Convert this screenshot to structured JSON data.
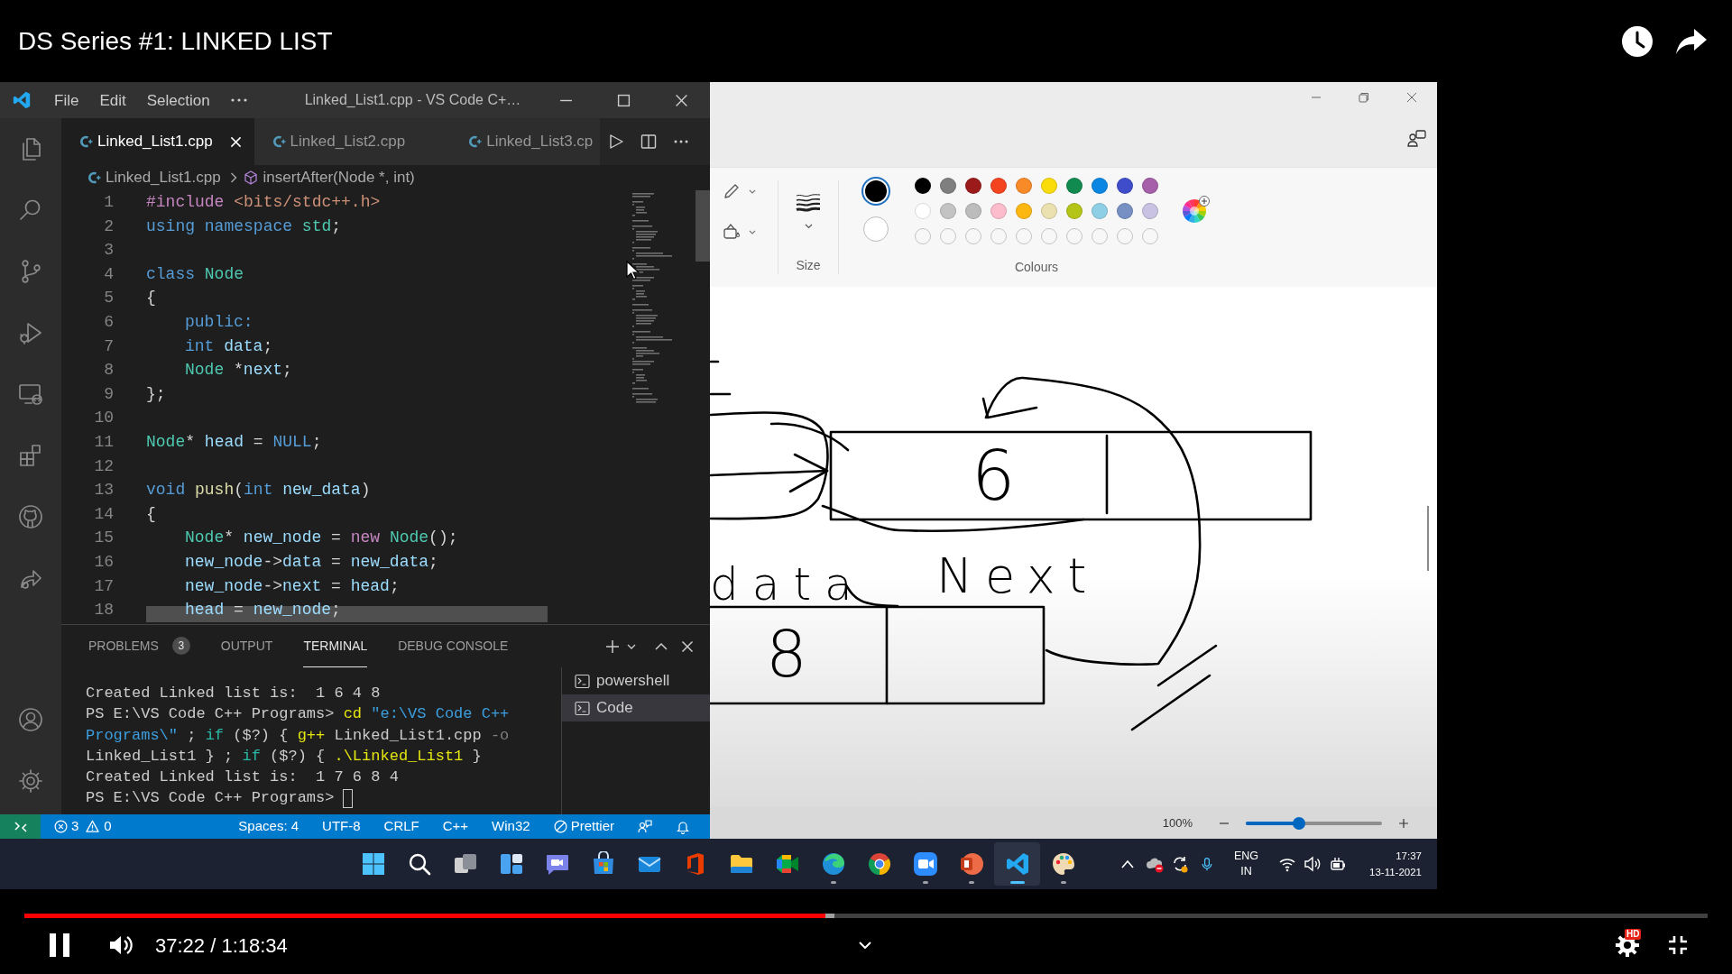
{
  "video": {
    "title": "DS Series #1: LINKED LIST"
  },
  "vscode": {
    "menu": [
      "File",
      "Edit",
      "Selection"
    ],
    "title": "Linked_List1.cpp - VS Code C+…",
    "tabs": [
      {
        "label": "Linked_List1.cpp",
        "selected": true
      },
      {
        "label": "Linked_List2.cpp",
        "selected": false
      },
      {
        "label": "Linked_List3.cp",
        "selected": false
      }
    ],
    "breadcrumb": {
      "file": "Linked_List1.cpp",
      "symbol": "insertAfter(Node *, int)"
    },
    "code": [
      {
        "number": "1",
        "tokens": [
          {
            "kind": "directive",
            "text": "#include"
          },
          {
            "kind": "string",
            "text": " <bits/stdc++.h>"
          }
        ]
      },
      {
        "number": "2",
        "tokens": [
          {
            "kind": "keyword",
            "text": "using"
          },
          {
            "kind": "keyword",
            "text": " namespace"
          },
          {
            "kind": "type",
            "text": " std"
          },
          {
            "kind": "plain",
            "text": ";"
          }
        ]
      },
      {
        "number": "3"
      },
      {
        "number": "4",
        "tokens": [
          {
            "kind": "keyword",
            "text": "class"
          },
          {
            "kind": "type",
            "text": " Node"
          }
        ]
      },
      {
        "number": "5",
        "tokens": [
          {
            "kind": "plain",
            "text": "{"
          }
        ],
        "children": [
          {
            "number": "6",
            "tokens": [
              {
                "kind": "keyword",
                "text": "public:"
              }
            ]
          },
          {
            "number": "7",
            "tokens": [
              {
                "kind": "keyword",
                "text": "int"
              },
              {
                "kind": "variable",
                "text": " data"
              },
              {
                "kind": "plain",
                "text": ";"
              }
            ]
          },
          {
            "number": "8",
            "tokens": [
              {
                "kind": "type",
                "text": "Node"
              },
              {
                "kind": "plain",
                "text": " *"
              },
              {
                "kind": "variable",
                "text": "next"
              },
              {
                "kind": "plain",
                "text": ";"
              }
            ]
          }
        ]
      },
      {
        "number": "9",
        "tokens": [
          {
            "kind": "plain",
            "text": "};"
          }
        ]
      },
      {
        "number": "10"
      },
      {
        "number": "11",
        "tokens": [
          {
            "kind": "type",
            "text": "Node"
          },
          {
            "kind": "plain",
            "text": "*"
          },
          {
            "kind": "variable",
            "text": " head"
          },
          {
            "kind": "plain",
            "text": " ="
          },
          {
            "kind": "keyword",
            "text": " NULL"
          },
          {
            "kind": "plain",
            "text": ";"
          }
        ]
      },
      {
        "number": "12"
      },
      {
        "number": "13",
        "tokens": [
          {
            "kind": "keyword",
            "text": "void"
          },
          {
            "kind": "function",
            "text": " push"
          },
          {
            "kind": "plain",
            "text": "("
          },
          {
            "kind": "keyword",
            "text": "int"
          },
          {
            "kind": "variable",
            "text": " new_data"
          },
          {
            "kind": "plain",
            "text": ")"
          }
        ]
      },
      {
        "number": "14",
        "tokens": [
          {
            "kind": "plain",
            "text": "{"
          }
        ],
        "children": [
          {
            "number": "15",
            "tokens": [
              {
                "kind": "type",
                "text": "Node"
              },
              {
                "kind": "plain",
                "text": "*"
              },
              {
                "kind": "variable",
                "text": " new_node"
              },
              {
                "kind": "plain",
                "text": " ="
              },
              {
                "kind": "control",
                "text": " new"
              },
              {
                "kind": "type",
                "text": " Node"
              },
              {
                "kind": "plain",
                "text": "();"
              }
            ]
          },
          {
            "number": "16",
            "tokens": [
              {
                "kind": "variable",
                "text": "new_node"
              },
              {
                "kind": "plain",
                "text": "->"
              },
              {
                "kind": "variable",
                "text": "data"
              },
              {
                "kind": "plain",
                "text": " ="
              },
              {
                "kind": "variable",
                "text": " new_data"
              },
              {
                "kind": "plain",
                "text": ";"
              }
            ]
          },
          {
            "number": "17",
            "tokens": [
              {
                "kind": "variable",
                "text": "new_node"
              },
              {
                "kind": "plain",
                "text": "->"
              },
              {
                "kind": "variable",
                "text": "next"
              },
              {
                "kind": "plain",
                "text": " ="
              },
              {
                "kind": "variable",
                "text": " head"
              },
              {
                "kind": "plain",
                "text": ";"
              }
            ]
          },
          {
            "number": "18",
            "tokens": [
              {
                "kind": "variable",
                "text": "head"
              },
              {
                "kind": "plain",
                "text": " ="
              },
              {
                "kind": "variable",
                "text": " new_node"
              },
              {
                "kind": "plain",
                "text": ";"
              }
            ]
          }
        ]
      }
    ],
    "panel_tabs": [
      {
        "label": "PROBLEMS",
        "badge": "3",
        "selected": false
      },
      {
        "label": "OUTPUT",
        "selected": false
      },
      {
        "label": "TERMINAL",
        "selected": true
      },
      {
        "label": "DEBUG CONSOLE",
        "selected": false
      }
    ],
    "terminal": [
      {
        "tokens": [
          {
            "kind": "text",
            "text": "Created Linked list is:  1 6 4 8"
          }
        ]
      },
      {
        "tokens": [
          {
            "kind": "text",
            "text": "PS E:\\VS Code C++ Programs> "
          },
          {
            "kind": "command",
            "text": "cd"
          },
          {
            "kind": "string",
            "text": " \"e:\\VS Code C++"
          }
        ]
      },
      {
        "tokens": [
          {
            "kind": "string",
            "text": "Programs\\\""
          },
          {
            "kind": "text",
            "text": " ; "
          },
          {
            "kind": "keyword",
            "text": "if"
          },
          {
            "kind": "text",
            "text": " ($?) { "
          },
          {
            "kind": "command",
            "text": "g++"
          },
          {
            "kind": "text",
            "text": " Linked_List1.cpp "
          },
          {
            "kind": "flag",
            "text": "-o"
          }
        ]
      },
      {
        "tokens": [
          {
            "kind": "text",
            "text": "Linked_List1 } ; "
          },
          {
            "kind": "keyword",
            "text": "if"
          },
          {
            "kind": "text",
            "text": " ($?) { "
          },
          {
            "kind": "command",
            "text": ".\\Linked_List1"
          },
          {
            "kind": "text",
            "text": " }"
          }
        ]
      },
      {
        "tokens": [
          {
            "kind": "text",
            "text": "Created Linked list is:  1 7 6 8 4"
          }
        ]
      },
      {
        "tokens": [
          {
            "kind": "text",
            "text": "PS E:\\VS Code C++ Programs>"
          }
        ],
        "cursor": true
      }
    ],
    "terminals": [
      {
        "label": "powershell",
        "selected": false
      },
      {
        "label": "Code",
        "selected": true
      }
    ],
    "status_bar": {
      "errors": "3",
      "warnings": "0",
      "items": [
        "Spaces: 4",
        "UTF-8",
        "CRLF",
        "C++",
        "Win32"
      ],
      "formatter": "Prettier"
    }
  },
  "paint": {
    "size_label": "Size",
    "colours_label": "Colours",
    "current_colours": [
      {
        "color": "#000000",
        "selected": true
      },
      {
        "color": "#ffffff",
        "selected": false
      }
    ],
    "palette": [
      {
        "kind": "swatch",
        "color": "#000000"
      },
      {
        "kind": "swatch",
        "color": "#7f7f7f"
      },
      {
        "kind": "swatch",
        "color": "#9b1b1b"
      },
      {
        "kind": "swatch",
        "color": "#f4441f"
      },
      {
        "kind": "swatch",
        "color": "#f98a28"
      },
      {
        "kind": "swatch",
        "color": "#fbdc0b"
      },
      {
        "kind": "swatch",
        "color": "#118a4f"
      },
      {
        "kind": "swatch",
        "color": "#0b86e3"
      },
      {
        "kind": "swatch",
        "color": "#3f4dcb"
      },
      {
        "kind": "swatch",
        "color": "#a65fa9"
      },
      {
        "kind": "swatch",
        "color": "#ffffff"
      },
      {
        "kind": "swatch",
        "color": "#c3c3c3"
      },
      {
        "kind": "swatch",
        "color": "#bcbcbc"
      },
      {
        "kind": "swatch",
        "color": "#fdbccb"
      },
      {
        "kind": "swatch",
        "color": "#fdb712"
      },
      {
        "kind": "swatch",
        "color": "#ebe0b0"
      },
      {
        "kind": "swatch",
        "color": "#b5c518"
      },
      {
        "kind": "swatch",
        "color": "#8ecfe6"
      },
      {
        "kind": "swatch",
        "color": "#7690c4"
      },
      {
        "kind": "swatch",
        "color": "#c9c2e3"
      },
      {
        "kind": "empty"
      },
      {
        "kind": "empty"
      },
      {
        "kind": "empty"
      },
      {
        "kind": "empty"
      },
      {
        "kind": "empty"
      },
      {
        "kind": "empty"
      },
      {
        "kind": "empty"
      },
      {
        "kind": "empty"
      },
      {
        "kind": "empty"
      },
      {
        "kind": "empty"
      }
    ],
    "canvas_labels": [
      {
        "text": "6"
      },
      {
        "text": "data"
      },
      {
        "text": "Next"
      },
      {
        "text": "8"
      }
    ],
    "zoom": {
      "label": "100%",
      "level": 0.39
    }
  },
  "taskbar": {
    "apps": [
      {
        "running": false,
        "selected": false
      },
      {
        "running": false,
        "selected": false
      },
      {
        "running": false,
        "selected": false
      },
      {
        "running": false,
        "selected": false
      },
      {
        "running": false,
        "selected": false
      },
      {
        "running": false,
        "selected": false
      },
      {
        "running": false,
        "selected": false
      },
      {
        "running": false,
        "selected": false
      },
      {
        "running": false,
        "selected": false
      },
      {
        "running": false,
        "selected": false
      },
      {
        "running": true,
        "selected": false
      },
      {
        "running": false,
        "selected": false
      },
      {
        "running": true,
        "selected": false
      },
      {
        "running": true,
        "selected": false
      },
      {
        "running": true,
        "selected": true
      },
      {
        "running": true,
        "selected": false
      }
    ],
    "language": [
      "ENG",
      "IN"
    ],
    "time": "17:37",
    "date": "13-11-2021"
  },
  "player": {
    "progress": {
      "level": 0.476
    },
    "time": "37:22 / 1:18:34",
    "quality_badge": "HD"
  }
}
